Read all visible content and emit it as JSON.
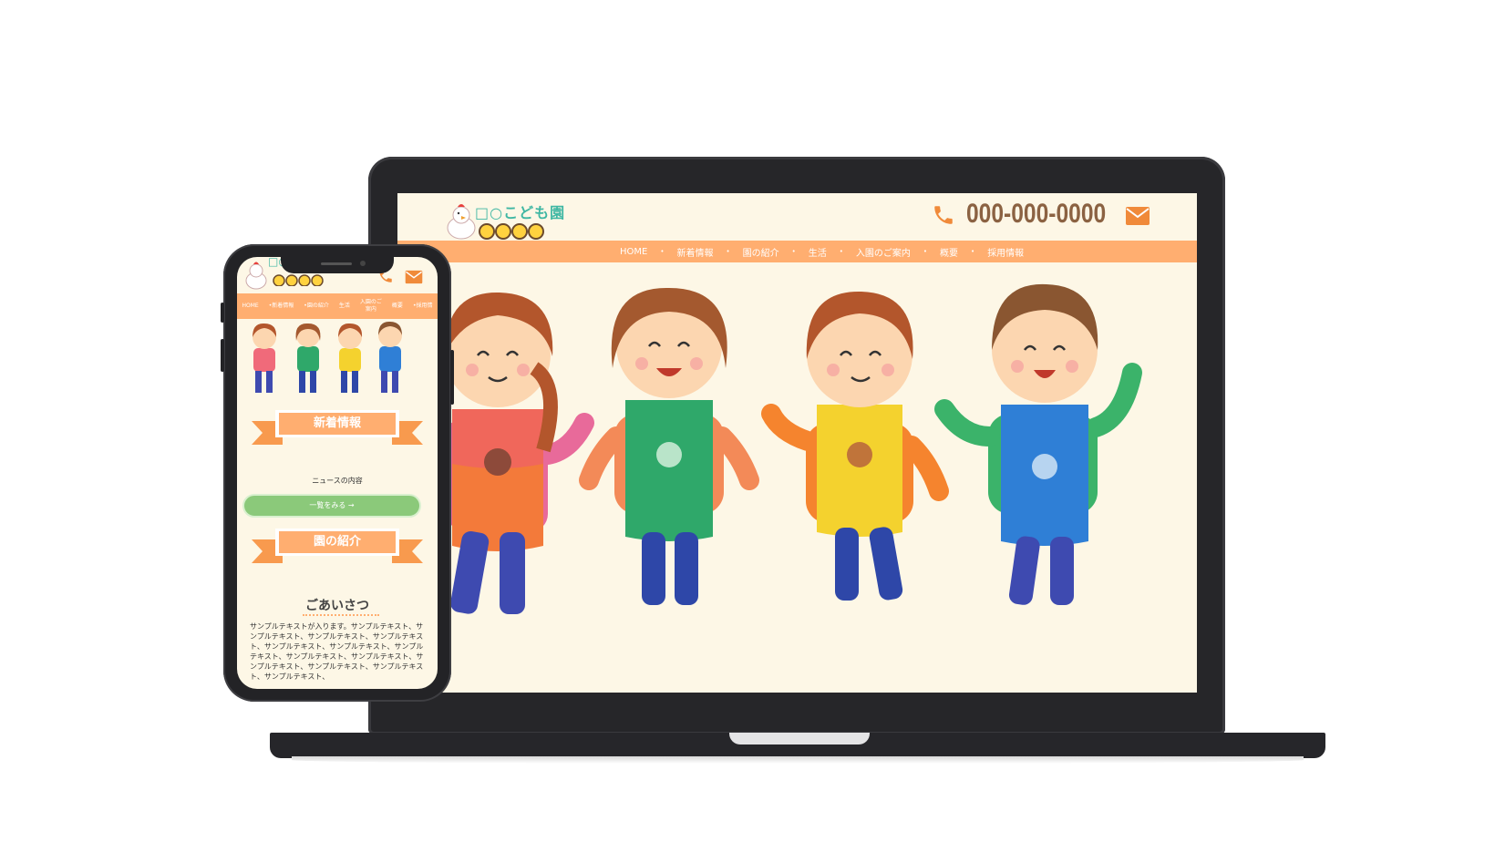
{
  "laptop": {
    "logo": {
      "text": "□○こども園"
    },
    "header": {
      "phone": "000-000-0000"
    },
    "nav": {
      "items": [
        "HOME",
        "新着情報",
        "園の紹介",
        "生活",
        "入園のご案内",
        "概要",
        "採用情報"
      ],
      "separator": "•"
    }
  },
  "phone": {
    "logo": {
      "text": "□○こども園"
    },
    "nav": {
      "items": [
        "HOME",
        "•新着情報",
        "•園の紹介",
        "生活",
        "入園のご\n案内",
        "概要",
        "•採用情"
      ],
      "separator": "•"
    },
    "news": {
      "heading": "新着情報",
      "content": "ニュースの内容",
      "more_button": "一覧をみる →"
    },
    "about": {
      "heading": "園の紹介",
      "greeting": "ごあいさつ",
      "body": "サンプルテキストが入ります。サンプルテキスト、サンプルテキスト、サンプルテキスト、サンプルテキスト、サンプルテキスト、サンプルテキスト、サンプルテキスト、サンプルテキスト、サンプルテキスト、サンプルテキスト、サンプルテキスト、サンプルテキスト、サンプルテキスト、"
    }
  },
  "colors": {
    "nav": "#ffae70",
    "page_bg": "#fdf7e6",
    "logo": "#3fb7a3",
    "phone_text": "#8b6242",
    "button": "#8bc97a"
  },
  "icons": [
    "phone-icon",
    "mail-icon",
    "chick-mascot-icon",
    "children-logo-icon"
  ]
}
